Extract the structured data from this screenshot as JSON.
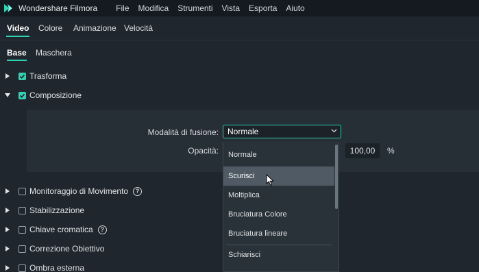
{
  "app": {
    "title": "Wondershare Filmora"
  },
  "menu": [
    "File",
    "Modifica",
    "Strumenti",
    "Vista",
    "Esporta",
    "Aiuto"
  ],
  "main_tabs": [
    "Video",
    "Colore",
    "Animazione",
    "Velocità"
  ],
  "sub_tabs": [
    "Base",
    "Maschera"
  ],
  "sections": {
    "transform": "Trasforma",
    "composition": "Composizione",
    "motion_tracking": "Monitoraggio di Movimento",
    "stabilization": "Stabilizzazione",
    "chroma_key": "Chiave cromatica",
    "lens_correction": "Correzione Obiettivo",
    "drop_shadow": "Ombra esterna"
  },
  "composition": {
    "blend_label": "Modalità di fusione:",
    "blend_value": "Normale",
    "opacity_label": "Opacità:",
    "opacity_value": "100,00",
    "opacity_unit": "%"
  },
  "dropdown": {
    "options": [
      "Normale",
      "Scurisci",
      "Moltiplica",
      "Bruciatura Colore",
      "Bruciatura lineare",
      "Schiarisci"
    ],
    "hovered": "Scurisci"
  },
  "colors": {
    "accent": "#2fd2b2",
    "background": "#1f262d",
    "menubar": "#141a20"
  },
  "icons": [
    "filmora-logo-icon",
    "expand-arrow-icon",
    "collapse-arrow-icon",
    "checkbox-checked-icon",
    "checkbox-icon",
    "help-icon",
    "chevron-down-icon",
    "mouse-pointer-icon"
  ]
}
